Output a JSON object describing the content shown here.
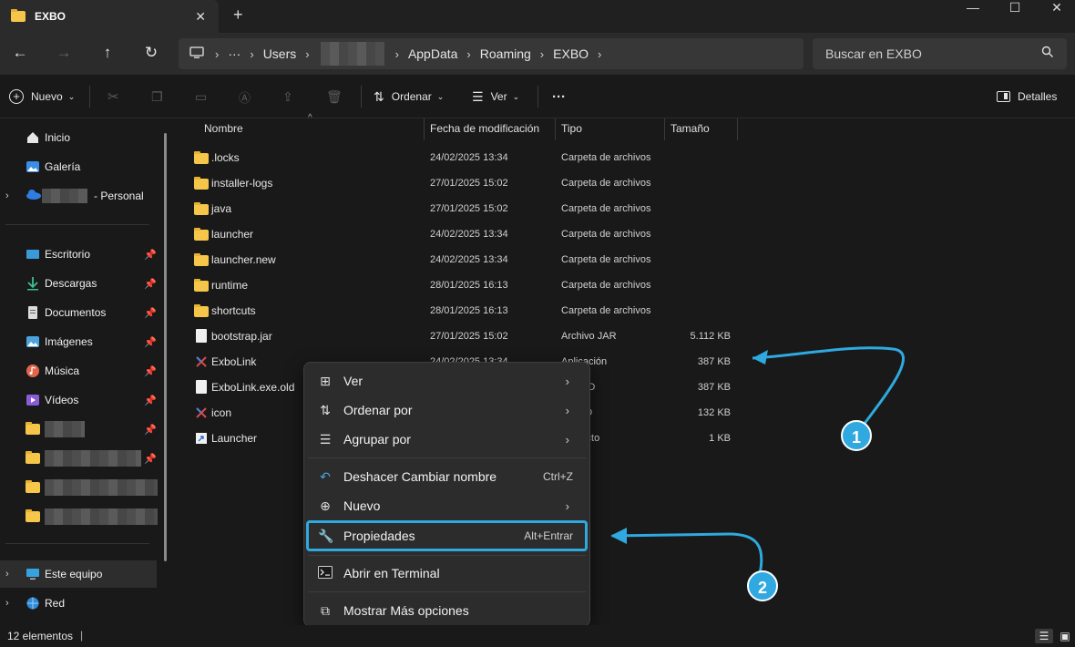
{
  "window": {
    "tab_title": "EXBO",
    "tab_close": "✕",
    "new_tab": "+",
    "minimize": "—",
    "maximize": "☐",
    "close": "✕"
  },
  "address": {
    "segments": [
      "Users",
      "AppData",
      "Roaming",
      "EXBO"
    ],
    "more": "···",
    "search_placeholder": "Buscar en EXBO"
  },
  "commandbar": {
    "new_label": "Nuevo",
    "sort_label": "Ordenar",
    "view_label": "Ver",
    "more_label": "···",
    "details_label": "Detalles"
  },
  "sidebar": {
    "home": "Inicio",
    "gallery": "Galería",
    "onedrive_suffix": "- Personal",
    "desktop": "Escritorio",
    "downloads": "Descargas",
    "documents": "Documentos",
    "pictures": "Imágenes",
    "music": "Música",
    "videos": "Vídeos",
    "this_pc": "Este equipo",
    "network": "Red"
  },
  "columns": {
    "name": "Nombre",
    "date": "Fecha de modificación",
    "type": "Tipo",
    "size": "Tamaño"
  },
  "files": [
    {
      "name": ".locks",
      "date": "24/02/2025 13:34",
      "type": "Carpeta de archivos",
      "size": "",
      "kind": "folder"
    },
    {
      "name": "installer-logs",
      "date": "27/01/2025 15:02",
      "type": "Carpeta de archivos",
      "size": "",
      "kind": "folder"
    },
    {
      "name": "java",
      "date": "27/01/2025 15:02",
      "type": "Carpeta de archivos",
      "size": "",
      "kind": "folder"
    },
    {
      "name": "launcher",
      "date": "24/02/2025 13:34",
      "type": "Carpeta de archivos",
      "size": "",
      "kind": "folder"
    },
    {
      "name": "launcher.new",
      "date": "24/02/2025 13:34",
      "type": "Carpeta de archivos",
      "size": "",
      "kind": "folder"
    },
    {
      "name": "runtime",
      "date": "28/01/2025 16:13",
      "type": "Carpeta de archivos",
      "size": "",
      "kind": "folder"
    },
    {
      "name": "shortcuts",
      "date": "28/01/2025 16:13",
      "type": "Carpeta de archivos",
      "size": "",
      "kind": "folder"
    },
    {
      "name": "bootstrap.jar",
      "date": "27/01/2025 15:02",
      "type": "Archivo JAR",
      "size": "5.112 KB",
      "kind": "file"
    },
    {
      "name": "ExboLink",
      "date": "24/02/2025 13:34",
      "type": "Aplicación",
      "size": "387 KB",
      "kind": "app"
    },
    {
      "name": "ExboLink.exe.old",
      "date": "",
      "type": "vo OLD",
      "size": "387 KB",
      "kind": "file"
    },
    {
      "name": "icon",
      "date": "",
      "type": "vo ICO",
      "size": "132 KB",
      "kind": "app"
    },
    {
      "name": "Launcher",
      "date": "",
      "type": "o directo",
      "size": "1 KB",
      "kind": "shortcut"
    }
  ],
  "context_menu": {
    "view": "Ver",
    "sort_by": "Ordenar por",
    "group_by": "Agrupar por",
    "undo": "Deshacer Cambiar nombre",
    "undo_shortcut": "Ctrl+Z",
    "new": "Nuevo",
    "properties": "Propiedades",
    "properties_shortcut": "Alt+Entrar",
    "terminal": "Abrir en Terminal",
    "more_options": "Mostrar Más opciones"
  },
  "status": {
    "count": "12 elementos"
  },
  "annotations": {
    "badge1": "1",
    "badge2": "2"
  },
  "colors": {
    "accent": "#2fa9df",
    "folder": "#f6c64a"
  }
}
